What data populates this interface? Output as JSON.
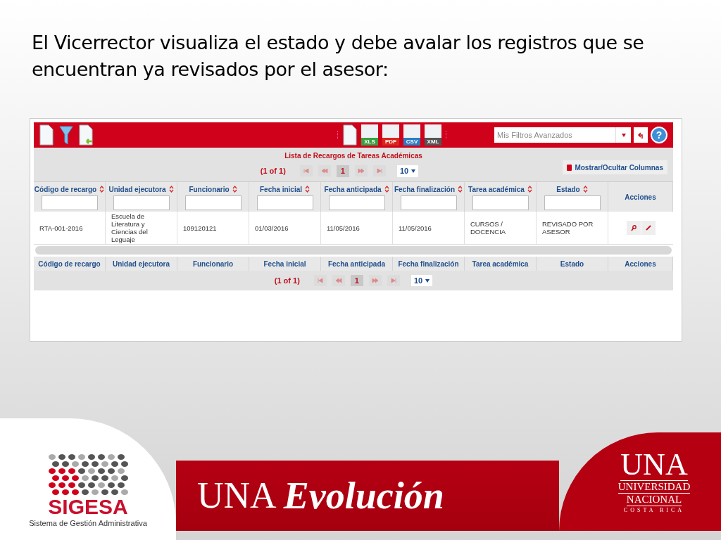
{
  "slide": {
    "heading": "El Vicerrector visualiza el estado y debe avalar los registros que se encuentran ya revisados por el asesor:"
  },
  "toolbar": {
    "exports": [
      {
        "kind": "blank"
      },
      {
        "kind": "labeled",
        "label": "XLS",
        "color": "#3aa043"
      },
      {
        "kind": "labeled",
        "label": "PDF",
        "color": "#d9261c"
      },
      {
        "kind": "labeled",
        "label": "CSV",
        "color": "#2f7cc1"
      },
      {
        "kind": "labeled",
        "label": "XML",
        "color": "#555555"
      }
    ],
    "filter_select": {
      "placeholder": "Mis Filtros Avanzados"
    },
    "help_label": "?"
  },
  "table": {
    "caption": "Lista de Recargos de Tareas Académicas",
    "paginator_top": {
      "summary": "(1 of 1)",
      "pages": [
        {
          "label": "1",
          "selected": true
        }
      ],
      "rows_per_page": "10"
    },
    "columns_button": "Mostrar/Ocultar Columnas",
    "columns": [
      {
        "label": "Código de recargo",
        "sortable": true,
        "filter": true
      },
      {
        "label": "Unidad ejecutora",
        "sortable": true,
        "filter": true
      },
      {
        "label": "Funcionario",
        "sortable": true,
        "filter": true
      },
      {
        "label": "Fecha inicial",
        "sortable": true,
        "filter": true
      },
      {
        "label": "Fecha anticipada",
        "sortable": true,
        "filter": true
      },
      {
        "label": "Fecha finalización",
        "sortable": true,
        "filter": true
      },
      {
        "label": "Tarea académica",
        "sortable": true,
        "filter": true
      },
      {
        "label": "Estado",
        "sortable": true,
        "filter": true
      },
      {
        "label": "Acciones",
        "sortable": false,
        "filter": false
      }
    ],
    "rows": [
      {
        "cells": [
          "RTA-001-2016",
          "Escuela de Literatura y Ciencias del Leguaje",
          "109120121",
          "01/03/2016",
          "11/05/2016",
          "11/05/2016",
          "CURSOS / DOCENCIA",
          "REVISADO POR ASESOR"
        ]
      }
    ],
    "footer_columns": [
      "Código de recargo",
      "Unidad ejecutora",
      "Funcionario",
      "Fecha inicial",
      "Fecha anticipada",
      "Fecha finalización",
      "Tarea académica",
      "Estado",
      "Acciones"
    ],
    "paginator_bottom": {
      "summary": "(1 of 1)",
      "pages": [
        {
          "label": "1",
          "selected": true
        }
      ],
      "rows_per_page": "10"
    }
  },
  "banner": {
    "sigesa_name": "SIGESA",
    "sigesa_subtitle": "Sistema de Gestión Administrativa",
    "slogan_left": "UNA",
    "slogan_right": "Evolución",
    "una": "UNA",
    "university_lines": [
      "UNIVERSIDAD",
      "NACIONAL"
    ],
    "country": "COSTA RICA"
  }
}
